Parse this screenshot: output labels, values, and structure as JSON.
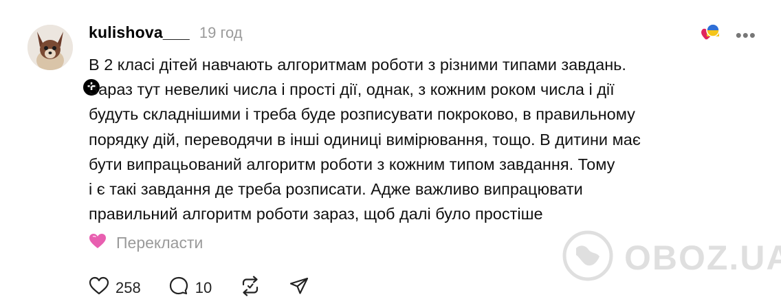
{
  "post": {
    "username": "kulishova___",
    "time": "19 год",
    "text_lines": [
      "В 2 класі дітей навчають алгоритмам роботи з різними типами завдань.",
      "Зараз тут невеликі числа і прості дії, однак, з кожним роком числа і дії",
      "будуть складнішими і треба буде розписувати покроково, в правильному",
      "порядку дій, переводячи в інші одиниці вимірювання, тощо. В дитини має",
      "бути випрацьований алгоритм роботи з кожним типом завдання. Тому",
      "і є такі завдання де треба розписати. Адже важливо випрацювати",
      "правильний алгоритм роботи зараз, щоб далі було простіше"
    ],
    "translate_label": "Перекласти",
    "more_glyph": "•••",
    "follow_glyph": "+"
  },
  "actions": {
    "likes": "258",
    "comments": "10"
  },
  "watermark": {
    "text": "OBOZ.UA"
  },
  "icons": {
    "like": "heart-icon",
    "comment": "comment-icon",
    "repost": "repost-icon",
    "share": "send-icon",
    "reactions": "heart-flag-reaction-icon",
    "translate_emoji": "pink-heart-icon"
  },
  "colors": {
    "muted": "#9a9a9a",
    "heart": "#e0245e",
    "pink": "#e85fb0"
  }
}
